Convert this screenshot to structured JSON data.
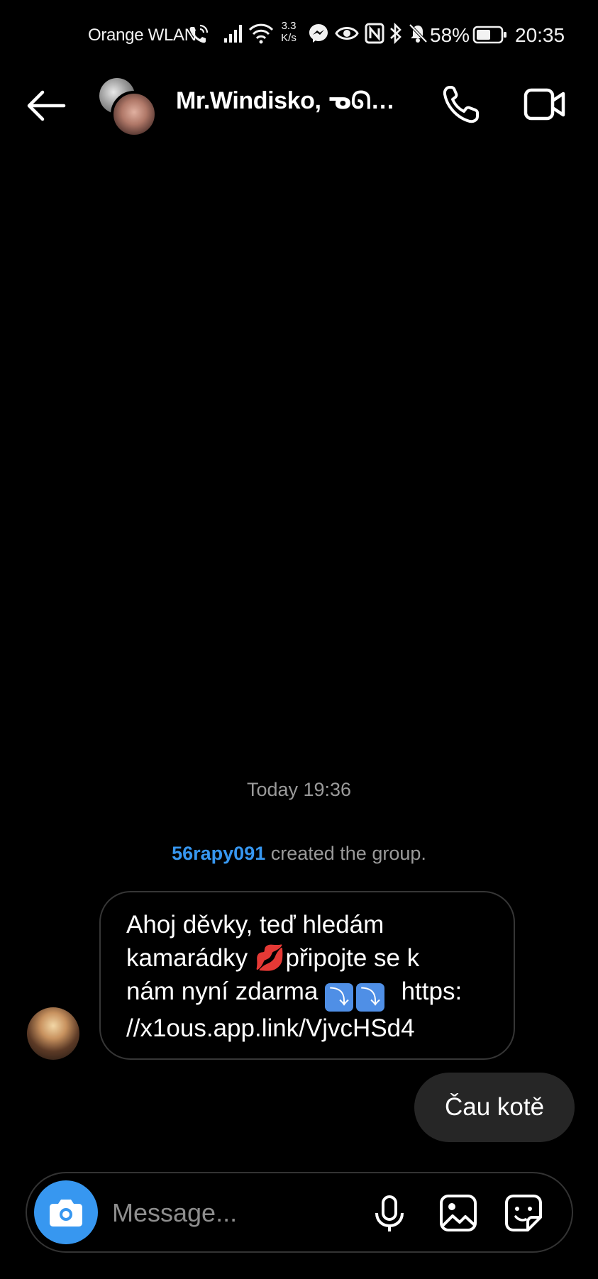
{
  "status_bar": {
    "carrier": "Orange WLAN",
    "net_speed_value": "3.3",
    "net_speed_unit": "K/s",
    "battery": "58%",
    "time": "20:35",
    "icons": [
      "wifi-call-icon",
      "signal-icon",
      "wifi-icon",
      "messenger-icon",
      "eye-icon",
      "nfc-icon",
      "bluetooth-icon",
      "bell-off-icon",
      "battery-icon"
    ]
  },
  "header": {
    "title": "Mr.Windisko, ᓀᘏᐟᐟ…",
    "icons": [
      "back-arrow-icon",
      "phone-icon",
      "video-camera-icon"
    ]
  },
  "thread": {
    "timestamp": "Today 19:36",
    "system_message": {
      "creator": "56rapy091",
      "text": " created the group."
    },
    "incoming": {
      "line1": "Ahoj děvky, teď hledám",
      "line2_a": "kamarádky ",
      "line2_emoji": "💋",
      "line2_b": "připojte se k",
      "line3_a": "nám nyní zdarma ",
      "line3_arrow1": "⤵",
      "line3_arrow2": "⤵",
      "line3_b": "  https:",
      "line4": "//x1ous.app.link/VjvcHSd4"
    },
    "outgoing": {
      "text": "Čau kotě"
    }
  },
  "composer": {
    "placeholder": "Message...",
    "icons": [
      "camera-icon",
      "microphone-icon",
      "gallery-icon",
      "sticker-icon"
    ]
  },
  "colors": {
    "background": "#000000",
    "accent": "#3797f0",
    "outgoing_bubble": "#262626",
    "incoming_border": "#363636",
    "muted_text": "#9a9a9a"
  }
}
